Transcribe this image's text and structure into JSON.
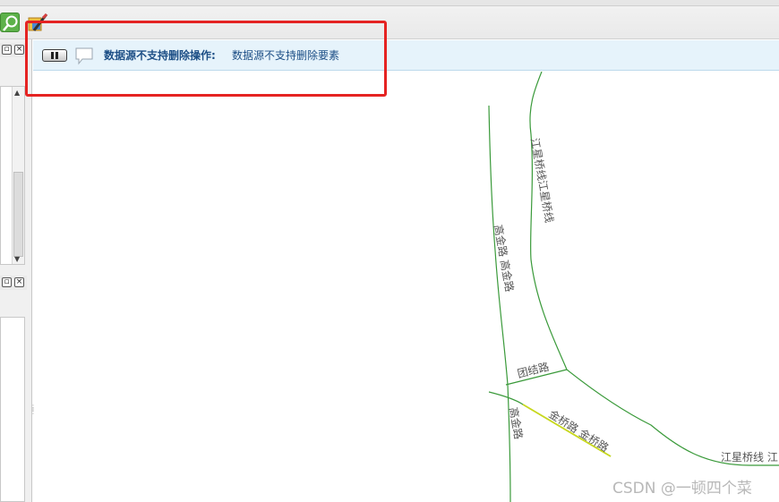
{
  "toolbar": {
    "icons": [
      "zoom-icon",
      "edit-icon"
    ]
  },
  "message": {
    "title": "数据源不支持删除操作",
    "separator": ":",
    "text": "数据源不支持删除要素"
  },
  "map": {
    "labels": {
      "jiangxing_vertical": "江星桥线江星桥线",
      "gaojin_upper": "高金路 高金路",
      "tuanjie": "团结路",
      "gaojin_lower": "高金路",
      "jinqiao": "金桥路 金桥路",
      "jiangxing_bottom": "江星桥线 江"
    },
    "colors": {
      "road": "#3a9a3a",
      "selected_road": "#c8d81e"
    }
  },
  "watermark": "CSDN @一顿四个菜",
  "colors": {
    "highlight": "#e52322",
    "message_bg": "#e6f3fb",
    "message_text": "#1d4f86"
  }
}
